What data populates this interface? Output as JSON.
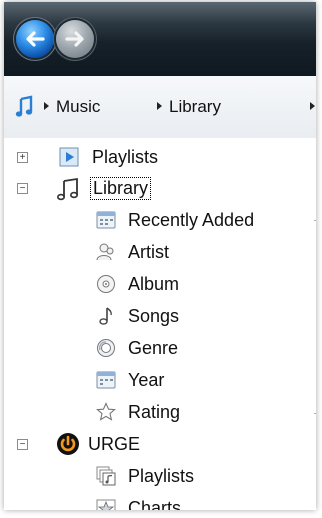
{
  "nav": {
    "back_icon": "back-arrow-icon",
    "forward_icon": "forward-arrow-icon"
  },
  "breadcrumb": {
    "items": [
      "Music",
      "Library"
    ]
  },
  "tree": {
    "playlists": "Playlists",
    "library": "Library",
    "library_children": [
      "Recently Added",
      "Artist",
      "Album",
      "Songs",
      "Genre",
      "Year",
      "Rating"
    ],
    "urge": "URGE",
    "urge_children": [
      "Playlists",
      "Charts"
    ]
  },
  "colors": {
    "accent": "#2f8fe8",
    "nav_dark": "#17212a",
    "selection_outline": "#000000"
  }
}
